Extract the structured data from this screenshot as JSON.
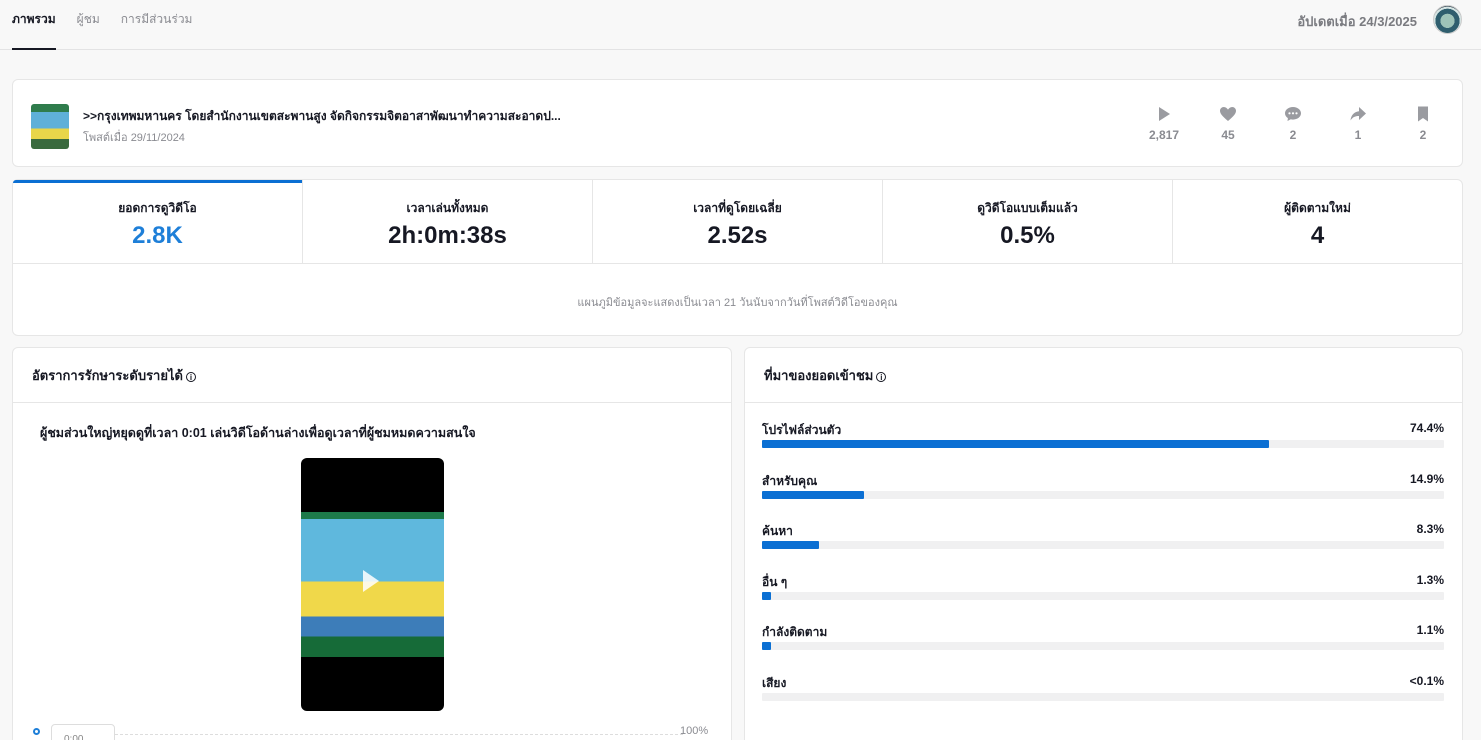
{
  "header": {
    "tabs": [
      "ภาพรวม",
      "ผู้ชม",
      "การมีส่วนร่วม"
    ],
    "updated": "อัปเดตเมื่อ 24/3/2025"
  },
  "post": {
    "title": ">>กรุงเทพมหานคร โดยสำนักงานเขตสะพานสูง จัดกิจกรรมจิตอาสาพัฒนาทำความสะอาดป...",
    "date": "โพสต์เมื่อ 29/11/2024",
    "stats": [
      {
        "icon": "play-icon",
        "value": "2,817"
      },
      {
        "icon": "heart-icon",
        "value": "45"
      },
      {
        "icon": "comment-icon",
        "value": "2"
      },
      {
        "icon": "share-icon",
        "value": "1"
      },
      {
        "icon": "bookmark-icon",
        "value": "2"
      }
    ]
  },
  "metrics": {
    "tabs": [
      {
        "label": "ยอดการดูวิดีโอ",
        "value": "2.8K"
      },
      {
        "label": "เวลาเล่นทั้งหมด",
        "value": "2h:0m:38s"
      },
      {
        "label": "เวลาที่ดูโดยเฉลี่ย",
        "value": "2.52s"
      },
      {
        "label": "ดูวิดีโอแบบเต็มแล้ว",
        "value": "0.5%"
      },
      {
        "label": "ผู้ติดตามใหม่",
        "value": "4"
      }
    ],
    "note": "แผนภูมิข้อมูลจะแสดงเป็นเวลา 21 วันนับจากวันที่โพสต์วิดีโอของคุณ"
  },
  "retention": {
    "title": "อัตราการรักษาระดับรายได้",
    "text": "ผู้ชมส่วนใหญ่หยุดดูที่เวลา 0:01 เล่นวิดีโอด้านล่างเพื่อดูเวลาที่ผู้ชมหมดความสนใจ",
    "time": "0:00",
    "pct_label": "100%"
  },
  "sources": {
    "title": "ที่มาของยอดเข้าชม",
    "items": [
      {
        "name": "โปรไฟล์ส่วนตัว",
        "pct": "74.4%",
        "value": 74.4
      },
      {
        "name": "สำหรับคุณ",
        "pct": "14.9%",
        "value": 14.9
      },
      {
        "name": "ค้นหา",
        "pct": "8.3%",
        "value": 8.3
      },
      {
        "name": "อื่น ๆ",
        "pct": "1.3%",
        "value": 1.3
      },
      {
        "name": "กำลังติดตาม",
        "pct": "1.1%",
        "value": 1.1
      },
      {
        "name": "เสียง",
        "pct": "<0.1%",
        "value": 0
      }
    ]
  },
  "colors": {
    "accent": "#0b6fd3",
    "value_blue": "#1e7fd8"
  }
}
